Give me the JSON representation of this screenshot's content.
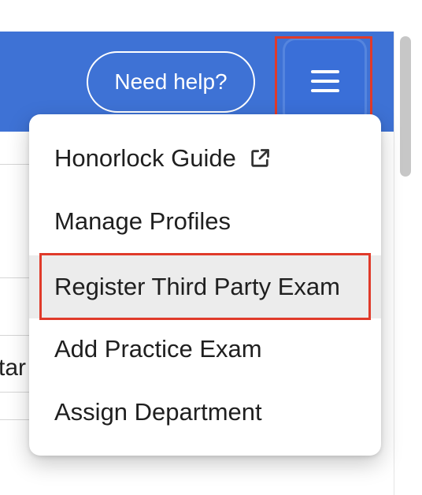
{
  "header": {
    "help_label": "Need help?",
    "menu_icon": "hamburger-icon",
    "color": "#3e72d5"
  },
  "menu": {
    "items": [
      {
        "label": "Honorlock Guide",
        "icon": "external-link-icon"
      },
      {
        "label": "Manage Profiles"
      },
      {
        "label": "Register Third Party Exam",
        "active": true
      },
      {
        "label": "Add Practice Exam"
      },
      {
        "label": "Assign Department"
      }
    ]
  },
  "background": {
    "partial_text": "tar"
  },
  "annotation_color": "#e03a2a"
}
